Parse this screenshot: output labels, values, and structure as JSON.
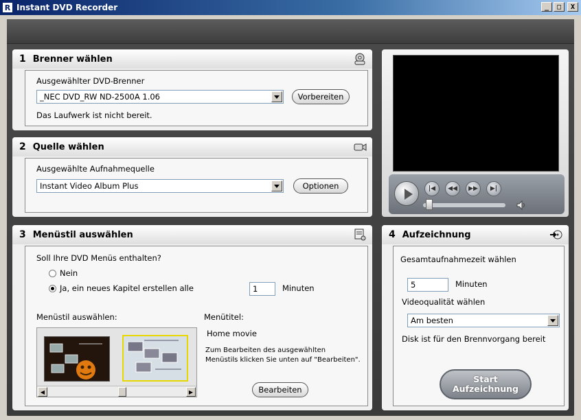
{
  "window": {
    "title": "Instant DVD Recorder",
    "app_icon": "R",
    "minimize": "_",
    "maximize": "□",
    "close": "X"
  },
  "step1": {
    "number": "1",
    "title": "Brenner wählen",
    "icon": "burner-icon",
    "drive_label": "Ausgewählter DVD-Brenner",
    "drive_value": "_NEC    DVD_RW ND-2500A 1.06",
    "prepare_button": "Vorbereiten",
    "status": "Das Laufwerk ist nicht bereit."
  },
  "step2": {
    "number": "2",
    "title": "Quelle wählen",
    "icon": "camcorder-icon",
    "source_label": "Ausgewählte Aufnahmequelle",
    "source_value": "Instant Video Album Plus",
    "options_button": "Optionen"
  },
  "step3": {
    "number": "3",
    "title": "Menüstil auswählen",
    "icon": "menu-style-icon",
    "question": "Soll Ihre DVD Menüs enthalten?",
    "option_no": "Nein",
    "option_yes": "Ja, ein neues Kapitel erstellen alle",
    "selected_option": "yes",
    "interval_value": "1",
    "interval_unit": "Minuten",
    "style_label": "Menüstil auswählen:",
    "menu_title_label": "Menütitel:",
    "menu_title_value": "Home movie",
    "edit_hint_line1": "Zum Bearbeiten des ausgewählten",
    "edit_hint_line2": "Menüstils klicken Sie unten auf \"Bearbeiten\".",
    "edit_button": "Bearbeiten",
    "selected_thumbnail": 2
  },
  "step4": {
    "number": "4",
    "title": "Aufzeichnung",
    "icon": "record-arrow-icon",
    "time_label": "Gesamtaufnahmezeit wählen",
    "time_value": "5",
    "time_unit": "Minuten",
    "quality_label": "Videoqualität wählen",
    "quality_value": "Am besten",
    "status": "Disk ist für den Brennvorgang bereit",
    "start_line1": "Start",
    "start_line2": "Aufzeichnung"
  },
  "player": {
    "buttons": [
      "skip-back-icon",
      "rewind-icon",
      "fast-forward-icon",
      "skip-forward-icon"
    ]
  },
  "colors": {
    "titlebar": "#0a246a",
    "frame": "#3d3d3d",
    "panel": "#f0f0f0",
    "selected_thumb_border": "#e8d800"
  }
}
